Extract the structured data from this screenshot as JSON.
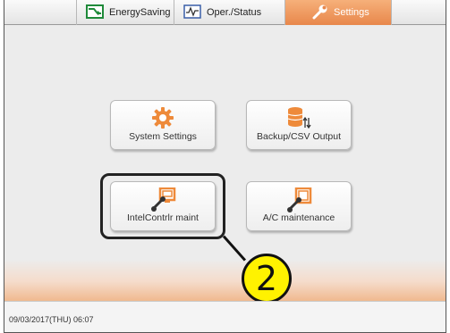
{
  "tabs": [
    {
      "label": "EnergySaving",
      "icon": "energy-saving-icon",
      "active": false
    },
    {
      "label": "Oper./Status",
      "icon": "pulse-chart-icon",
      "active": false
    },
    {
      "label": "Settings",
      "icon": "wrench-icon",
      "active": true
    }
  ],
  "menu": {
    "system_settings": "System Settings",
    "backup_csv": "Backup/CSV Output",
    "intel_controller": "IntelContrlr maint",
    "ac_maintenance": "A/C maintenance"
  },
  "callout": {
    "step": "2"
  },
  "status": {
    "datetime": "09/03/2017(THU) 06:07"
  },
  "colors": {
    "active_tab": "#e8874b",
    "accent_orange": "#ee8a3a",
    "callout_fill": "#fff200"
  }
}
